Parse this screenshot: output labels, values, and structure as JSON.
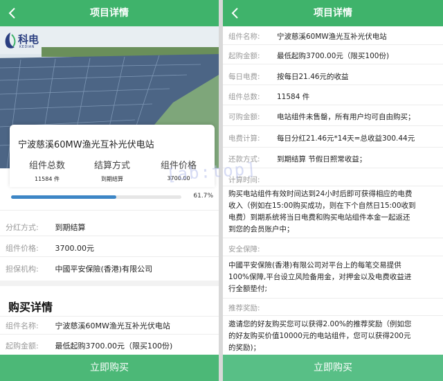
{
  "left": {
    "header_title": "项目详情",
    "logo_text": "科电",
    "logo_sub": "KEDIAN",
    "project_title": "宁波慈溪60MW渔光互补光伏电站",
    "stats": [
      {
        "label": "组件总数",
        "value": "11584 件"
      },
      {
        "label": "结算方式",
        "value": "到期结算"
      },
      {
        "label": "组件价格",
        "value": "3700.00"
      }
    ],
    "progress_fraction": 0.617,
    "progress_text": "61.7%",
    "info_rows": [
      {
        "key": "分红方式:",
        "value": "到期结算"
      },
      {
        "key": "组件价格:",
        "value": "3700.00元"
      },
      {
        "key": "担保机构:",
        "value": "中國平安保險(香港)有限公司"
      }
    ],
    "purchase_heading": "购买详情",
    "purchase_rows": [
      {
        "key": "组件名称:",
        "value": "宁波慈溪60MW渔光互补光伏电站"
      },
      {
        "key": "起购金额:",
        "value": "最低起购3700.00元（限买100份)"
      }
    ],
    "buy_button": "立即购买"
  },
  "right": {
    "header_title": "项目详情",
    "rows": [
      {
        "key": "组件名称:",
        "value": "宁波慈溪60MW渔光互补光伏电站"
      },
      {
        "key": "起购金额:",
        "value": "最低起购3700.00元（限买100份)"
      },
      {
        "key": "每日电费:",
        "value": "按每日21.46元的收益"
      },
      {
        "key": "组件总数:",
        "value": "11584 件"
      },
      {
        "key": "可购金额:",
        "value": "电站组件未售罄，所有用户均可自由购买；"
      },
      {
        "key": "电费计算:",
        "value": "每日分红21.46元*14天=总收益300.44元"
      },
      {
        "key": "还款方式:",
        "value": "到期结算 节假日照常收益；"
      }
    ],
    "rule_label": "计算时间:",
    "rule_lines": [
      "购买电站组件有效时间达到24小时后即可获得相应的电费",
      "收入（例如在15:00购买成功，则在下个自然日15:00收到",
      "电费）到期系统将当日电费和购买电站组件本金一起返还",
      "到您的会员账户中；"
    ],
    "security_label": "安全保障:",
    "security_lines": [
      "中國平安保險(香港)有限公司对平台上的每笔交易提供",
      "100%保障,平台设立风险备用金，对押金以及电费收益进",
      "行全额垫付;"
    ],
    "reward_label": "推荐奖励:",
    "reward_lines": [
      "邀请您的好友购买您可以获得2.00%的推荐奖励（例如您",
      "的好友购买价值10000元的电站组件，您可以获得200元",
      "的奖励)；"
    ],
    "buy_button": "立即购买"
  },
  "watermark": "[ab:top]",
  "colors": {
    "header": "#3fb36b",
    "button": "#4cb877",
    "progress": "#3d86c6"
  }
}
